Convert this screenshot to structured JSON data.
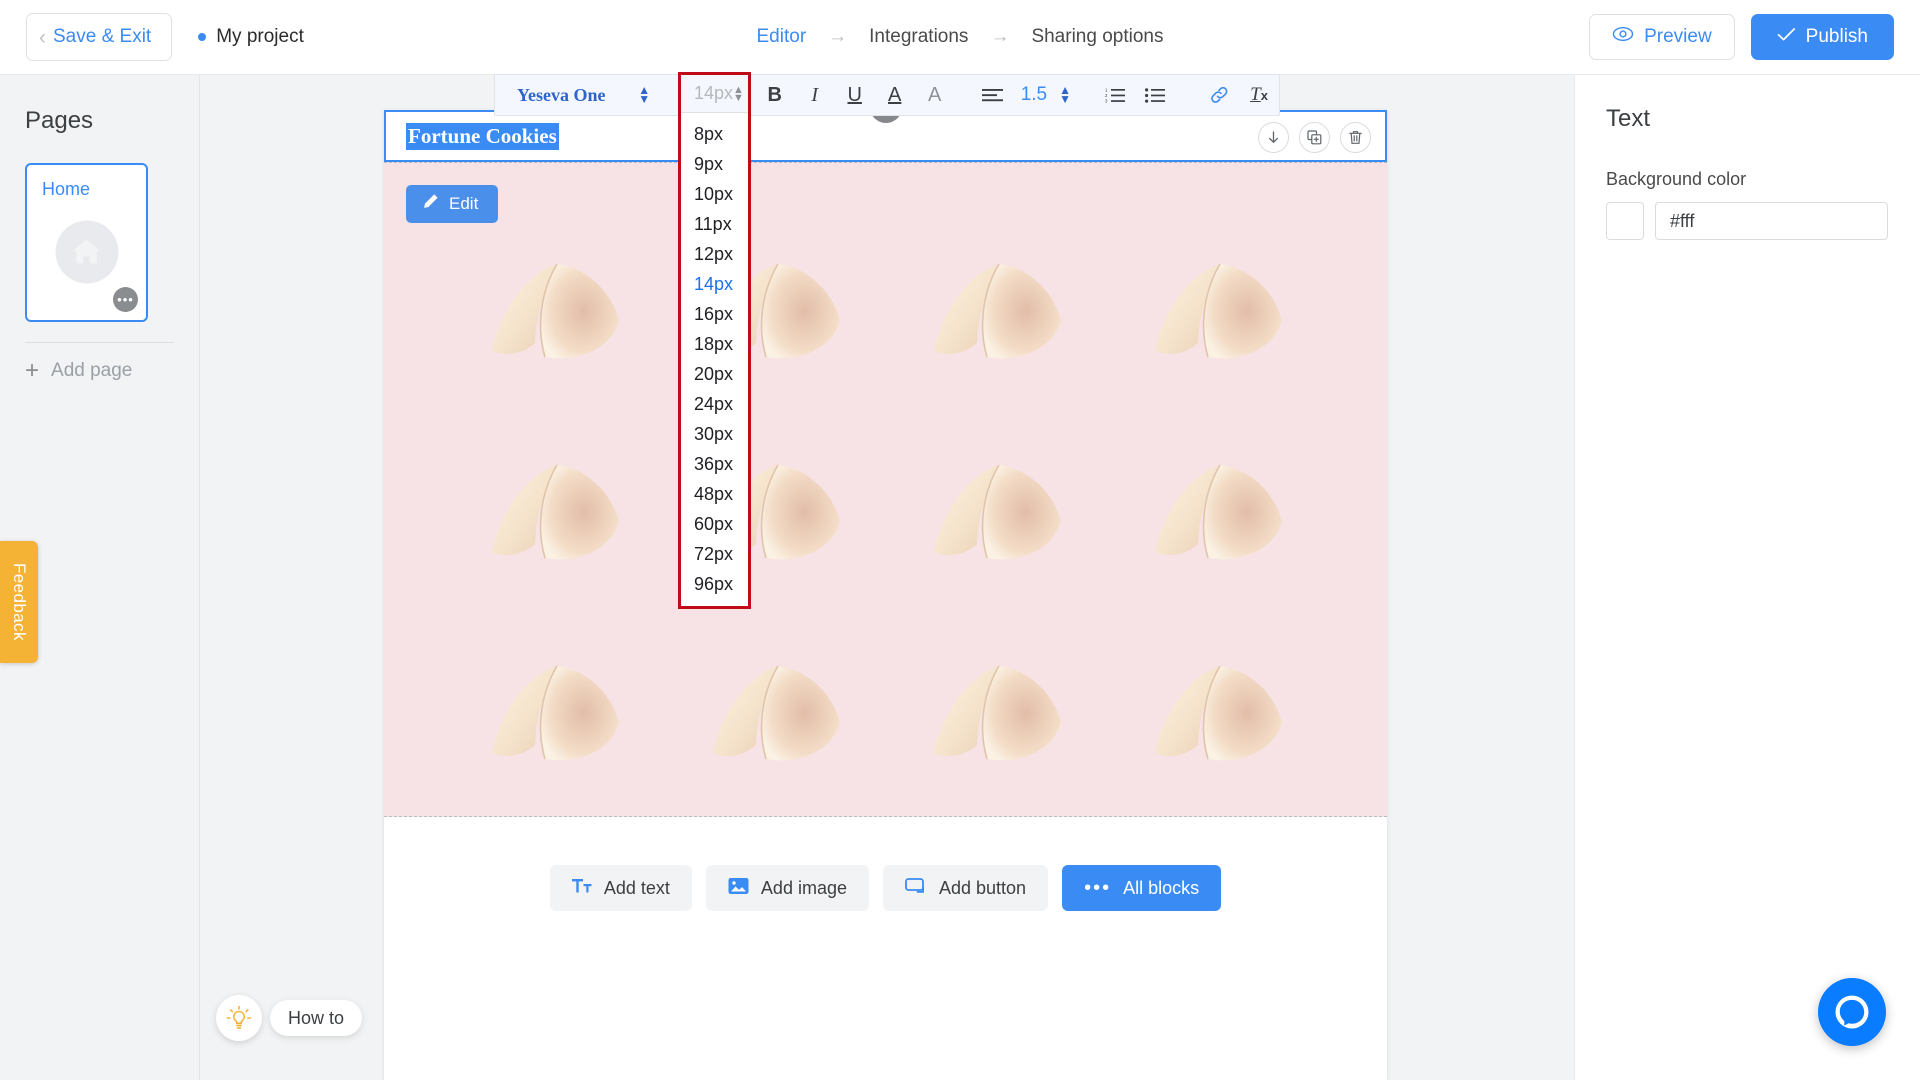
{
  "topbar": {
    "save_exit": "Save & Exit",
    "project_name": "My project",
    "breadcrumb": [
      {
        "label": "Editor",
        "active": true
      },
      {
        "label": "Integrations",
        "active": false
      },
      {
        "label": "Sharing options",
        "active": false
      }
    ],
    "breadcrumb_arrow": "→",
    "preview": "Preview",
    "publish": "Publish",
    "preview_icon": "eye-icon",
    "publish_icon": "check-icon",
    "back_chevron": "‹"
  },
  "sidebar": {
    "title": "Pages",
    "page": {
      "name": "Home",
      "icon": "home-icon",
      "menu_icon": "ellipsis-icon"
    },
    "add_page": "Add page",
    "add_page_icon": "plus-icon",
    "feedback": "Feedback",
    "feedback_color": "#f5b335"
  },
  "howto": {
    "label": "How to",
    "icon": "lightbulb-icon"
  },
  "text_toolbar": {
    "font_family": "Yeseva One",
    "font_size_value": "14px",
    "line_height": "1.5",
    "icons": [
      {
        "name": "bold-icon",
        "glyph": "B"
      },
      {
        "name": "italic-icon",
        "glyph": "I"
      },
      {
        "name": "underline-icon",
        "glyph": "U"
      },
      {
        "name": "text-color-icon",
        "glyph": "A"
      },
      {
        "name": "highlight-color-icon",
        "glyph": "A"
      },
      {
        "name": "align-icon",
        "glyph": "≡"
      },
      {
        "name": "ordered-list-icon",
        "glyph": "1."
      },
      {
        "name": "unordered-list-icon",
        "glyph": "•"
      },
      {
        "name": "link-icon",
        "glyph": "🔗"
      },
      {
        "name": "clear-format-icon",
        "glyph": "Tx"
      }
    ]
  },
  "size_dropdown": {
    "current": "14px",
    "selected": "14px",
    "options": [
      "8px",
      "9px",
      "10px",
      "11px",
      "12px",
      "14px",
      "16px",
      "18px",
      "20px",
      "24px",
      "30px",
      "36px",
      "48px",
      "60px",
      "72px",
      "96px"
    ],
    "highlight_border": "#c00b18"
  },
  "canvas": {
    "heading": "Fortune Cookies",
    "heading_selected": true,
    "edit_button": "Edit",
    "edit_icon": "pencil-icon",
    "block_background": "#f7e2e5",
    "block_actions": [
      {
        "name": "move-down-icon",
        "glyph": "↓"
      },
      {
        "name": "duplicate-icon",
        "glyph": "⧉"
      },
      {
        "name": "delete-icon",
        "glyph": "🗑"
      }
    ],
    "add_block_handle": "+",
    "image_count": 12,
    "image_alt": "fortune-cookie"
  },
  "bottom_tools": [
    {
      "label": "Add text",
      "icon": "text-icon",
      "primary": false
    },
    {
      "label": "Add image",
      "icon": "image-icon",
      "primary": false
    },
    {
      "label": "Add button",
      "icon": "button-icon",
      "primary": false
    },
    {
      "label": "All blocks",
      "icon": "ellipsis-icon",
      "primary": true
    }
  ],
  "right_panel": {
    "title": "Text",
    "background_color_label": "Background color",
    "background_color_value": "#fff",
    "swatch_color": "#ffffff"
  },
  "messenger": {
    "name": "messenger-chat-button",
    "color": "#0a7cff"
  },
  "accent_color": "#3b8bf5"
}
